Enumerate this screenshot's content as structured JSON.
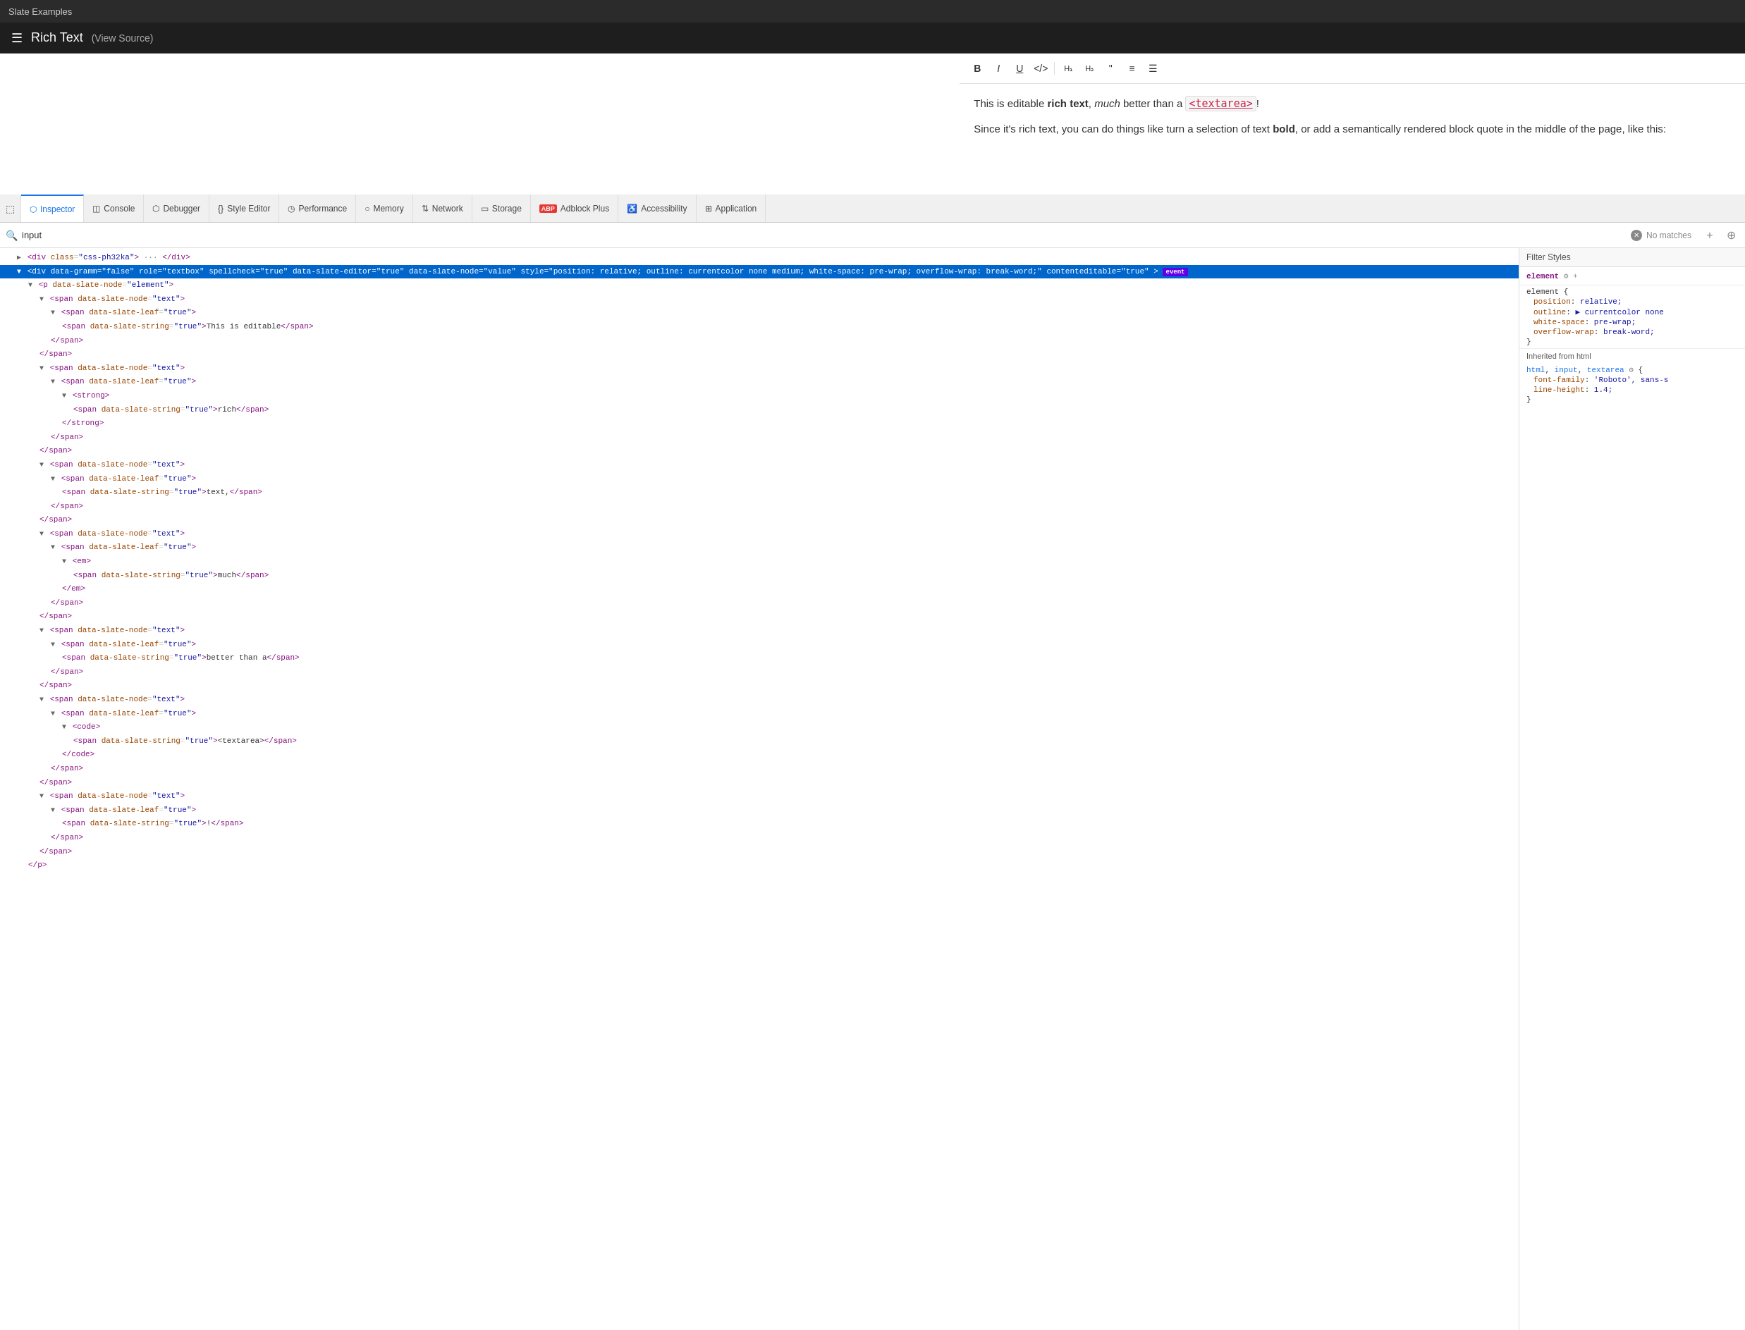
{
  "titleBar": {
    "label": "Slate Examples"
  },
  "appBar": {
    "menuIcon": "☰",
    "title": "Rich Text",
    "viewSource": "(View Source)"
  },
  "editorToolbar": {
    "buttons": [
      {
        "icon": "B",
        "label": "bold",
        "title": "Bold"
      },
      {
        "icon": "I",
        "label": "italic",
        "title": "Italic"
      },
      {
        "icon": "U̲",
        "label": "underline",
        "title": "Underline"
      },
      {
        "icon": "</>",
        "label": "code",
        "title": "Code"
      },
      {
        "icon": "▪",
        "label": "h1",
        "title": "Heading 1"
      },
      {
        "icon": "▫",
        "label": "h2",
        "title": "Heading 2"
      },
      {
        "icon": "❝",
        "label": "blockquote",
        "title": "Block Quote"
      },
      {
        "icon": "≡",
        "label": "ol",
        "title": "Numbered List"
      },
      {
        "icon": "☰",
        "label": "ul",
        "title": "Bulleted List"
      }
    ]
  },
  "editorContent": {
    "line1a": "This is editable ",
    "line1b": "rich text",
    "line1c": ", ",
    "line1d": "much",
    "line1e": " better than a ",
    "line1f": "<textarea>",
    "line1g": "!",
    "line2a": "Since it's rich text, you can do things like turn a selection of text ",
    "line2b": "bold",
    "line2c": ", or add a semantically rendered block quote in the middle of the page, like this:"
  },
  "devtools": {
    "tabs": [
      {
        "icon": "⬚",
        "label": "Inspector",
        "active": true
      },
      {
        "icon": "◫",
        "label": "Console",
        "active": false
      },
      {
        "icon": "⬡",
        "label": "Debugger",
        "active": false
      },
      {
        "icon": "{}",
        "label": "Style Editor",
        "active": false
      },
      {
        "icon": "◷",
        "label": "Performance",
        "active": false
      },
      {
        "icon": "○",
        "label": "Memory",
        "active": false
      },
      {
        "icon": "⇅",
        "label": "Network",
        "active": false
      },
      {
        "icon": "▭",
        "label": "Storage",
        "active": false
      },
      {
        "icon": "ABP",
        "label": "Adblock Plus",
        "active": false,
        "badge": true
      },
      {
        "icon": "♿",
        "label": "Accessibility",
        "active": false
      },
      {
        "icon": "⊞",
        "label": "Application",
        "active": false
      }
    ],
    "searchBar": {
      "placeholder": "input",
      "value": "input",
      "noMatchesLabel": "No matches",
      "addIcon": "+",
      "pickIcon": "⊕"
    },
    "htmlPanel": {
      "lines": [
        {
          "indent": 1,
          "content": "<div class=\"css-ph32ka\"> ··· </div>",
          "triangle": "▶",
          "type": "collapsed"
        },
        {
          "indent": 1,
          "content": "<div data-gramm=\"false\" role=\"textbox\" spellcheck=\"true\" data-slate-editor=\"true\" data-slate-node=\"value\" style=\"position: relative; outline: currentcolor none medium; white-space: pre-wrap; overflow-wrap: break-word;\" contenteditable=\"true\">",
          "triangle": "▼",
          "type": "open",
          "selected": true,
          "badge": "event"
        },
        {
          "indent": 2,
          "content": "<p data-slate-node=\"element\">",
          "triangle": "▼"
        },
        {
          "indent": 3,
          "content": "<span data-slate-node=\"text\">",
          "triangle": "▼"
        },
        {
          "indent": 4,
          "content": "<span data-slate-leaf=\"true\">",
          "triangle": "▼"
        },
        {
          "indent": 5,
          "content": "<span data-slate-string=\"true\">This is editable</span>"
        },
        {
          "indent": 4,
          "content": "</span>"
        },
        {
          "indent": 3,
          "content": "</span>"
        },
        {
          "indent": 3,
          "content": "<span data-slate-node=\"text\">",
          "triangle": "▼"
        },
        {
          "indent": 4,
          "content": "<span data-slate-leaf=\"true\">",
          "triangle": "▼"
        },
        {
          "indent": 5,
          "content": "<strong>",
          "triangle": "▼"
        },
        {
          "indent": 6,
          "content": "<span data-slate-string=\"true\">rich</span>"
        },
        {
          "indent": 5,
          "content": "</strong>"
        },
        {
          "indent": 4,
          "content": "</span>"
        },
        {
          "indent": 3,
          "content": "</span>"
        },
        {
          "indent": 3,
          "content": "<span data-slate-node=\"text\">",
          "triangle": "▼"
        },
        {
          "indent": 4,
          "content": "<span data-slate-leaf=\"true\">",
          "triangle": "▼"
        },
        {
          "indent": 5,
          "content": "<span data-slate-string=\"true\">text,</span>"
        },
        {
          "indent": 4,
          "content": "</span>"
        },
        {
          "indent": 3,
          "content": "</span>"
        },
        {
          "indent": 3,
          "content": "<span data-slate-node=\"text\">",
          "triangle": "▼"
        },
        {
          "indent": 4,
          "content": "<span data-slate-leaf=\"true\">",
          "triangle": "▼"
        },
        {
          "indent": 5,
          "content": "<em>",
          "triangle": "▼"
        },
        {
          "indent": 6,
          "content": "<span data-slate-string=\"true\">much</span>"
        },
        {
          "indent": 5,
          "content": "</em>"
        },
        {
          "indent": 4,
          "content": "</span>"
        },
        {
          "indent": 3,
          "content": "</span>"
        },
        {
          "indent": 3,
          "content": "<span data-slate-node=\"text\">",
          "triangle": "▼"
        },
        {
          "indent": 4,
          "content": "<span data-slate-leaf=\"true\">",
          "triangle": "▼"
        },
        {
          "indent": 5,
          "content": "<span data-slate-string=\"true\">better than a</span>"
        },
        {
          "indent": 4,
          "content": "</span>"
        },
        {
          "indent": 3,
          "content": "</span>"
        },
        {
          "indent": 3,
          "content": "<span data-slate-node=\"text\">",
          "triangle": "▼"
        },
        {
          "indent": 4,
          "content": "<span data-slate-leaf=\"true\">",
          "triangle": "▼"
        },
        {
          "indent": 5,
          "content": "<code>",
          "triangle": "▼"
        },
        {
          "indent": 6,
          "content": "<span data-slate-string=\"true\">&lt;textarea&gt;</span>"
        },
        {
          "indent": 5,
          "content": "</code>"
        },
        {
          "indent": 4,
          "content": "</span>"
        },
        {
          "indent": 3,
          "content": "</span>"
        },
        {
          "indent": 3,
          "content": "<span data-slate-node=\"text\">",
          "triangle": "▼"
        },
        {
          "indent": 4,
          "content": "<span data-slate-leaf=\"true\">",
          "triangle": "▼"
        },
        {
          "indent": 5,
          "content": "<span data-slate-string=\"true\">!</span>"
        },
        {
          "indent": 4,
          "content": "</span>"
        },
        {
          "indent": 3,
          "content": "</span>"
        },
        {
          "indent": 2,
          "content": "</p>"
        }
      ]
    },
    "stylesPanel": {
      "filterLabel": "Filter Styles",
      "elementLabel": "element",
      "gearIcon": "⚙",
      "plusIcon": "+",
      "selectorBlock": {
        "name": "element {",
        "props": [
          {
            "name": "position",
            "colon": ":",
            "value": "relative;"
          },
          {
            "name": "outline",
            "colon": ":",
            "value": "▶ currentcolor none"
          },
          {
            "name": "white-space",
            "colon": ":",
            "value": "pre-wrap;"
          },
          {
            "name": "overflow-wrap",
            "colon": ":",
            "value": "break-word;"
          }
        ],
        "close": "}"
      },
      "inheritedLabel": "Inherited from html",
      "inheritedSelector": "html, input, textarea {",
      "inheritedProps": [
        {
          "name": "font-family",
          "colon": ":",
          "value": "'Roboto', sans-s"
        },
        {
          "name": "line-height",
          "colon": ":",
          "value": "1.4;"
        }
      ],
      "inheritedClose": "}"
    }
  }
}
